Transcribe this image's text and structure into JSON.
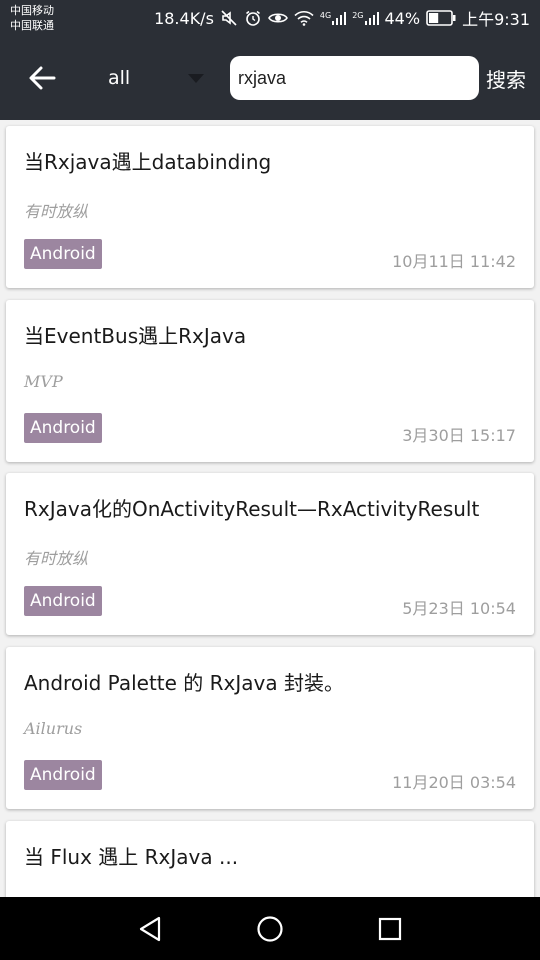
{
  "status_bar": {
    "carrier_1": "中国移动",
    "carrier_2": "中国联通",
    "network_speed": "18.4K/s",
    "battery_percent": "44%",
    "battery_level": 0.44,
    "time": "上午9:31",
    "signal_1_label": "4G",
    "signal_2_label": "2G",
    "icons": [
      "mute-icon",
      "alarm-icon",
      "eye-icon",
      "wifi-icon",
      "signal-icon",
      "battery-icon"
    ]
  },
  "toolbar": {
    "category": "all",
    "search_value": "rxjava",
    "search_label": "搜索",
    "icons": [
      "arrow-back-icon",
      "dropdown-triangle-icon"
    ]
  },
  "articles": [
    {
      "title": "当Rxjava遇上databinding",
      "author": "有时放纵",
      "tag": "Android",
      "time": "10月11日 11:42"
    },
    {
      "title": "当EventBus遇上RxJava",
      "author": "MVP",
      "tag": "Android",
      "time": "3月30日 15:17"
    },
    {
      "title": "RxJava化的OnActivityResult—RxActivityResult",
      "author": "有时放纵",
      "tag": "Android",
      "time": "5月23日 10:54"
    },
    {
      "title": "Android Palette 的 RxJava 封装。",
      "author": "Ailurus",
      "tag": "Android",
      "time": "11月20日 03:54"
    },
    {
      "title": "当 Flux 遇上 RxJava ...",
      "author": "",
      "tag": "",
      "time": ""
    }
  ],
  "nav_bar": {
    "icons": [
      "back-triangle-icon",
      "home-circle-icon",
      "recents-square-icon"
    ]
  },
  "colors": {
    "toolbar_bg": "#2b2f36",
    "tag_bg": "#9c86a0",
    "list_bg": "#f2f2f2",
    "muted_text": "#9e9e9e"
  }
}
